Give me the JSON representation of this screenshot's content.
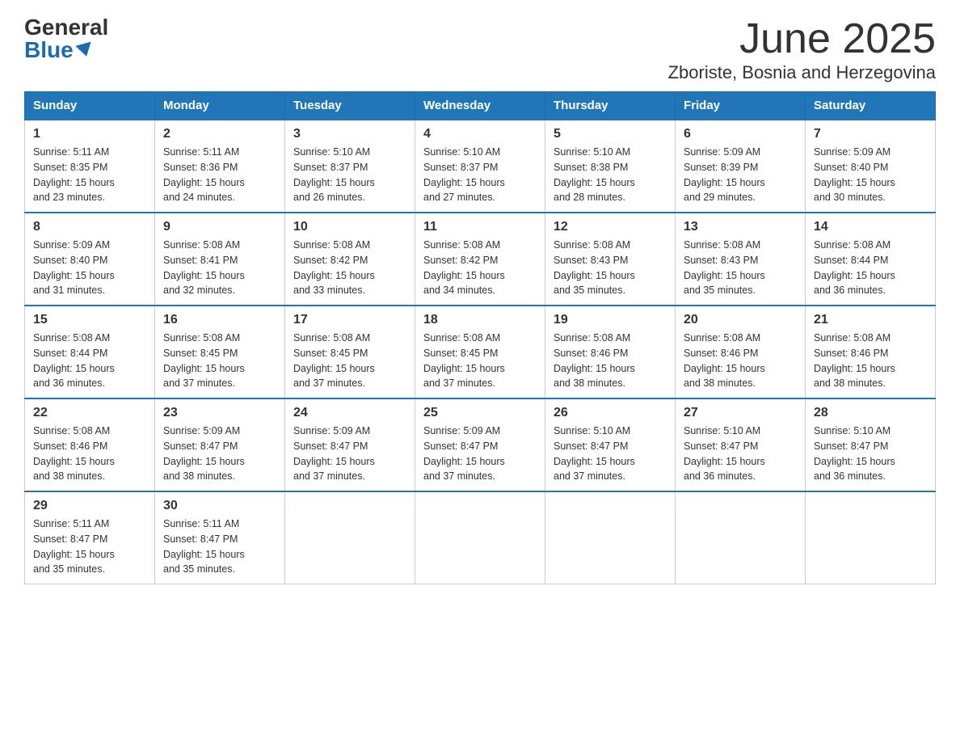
{
  "logo": {
    "general": "General",
    "blue": "Blue"
  },
  "title": "June 2025",
  "location": "Zboriste, Bosnia and Herzegovina",
  "weekdays": [
    "Sunday",
    "Monday",
    "Tuesday",
    "Wednesday",
    "Thursday",
    "Friday",
    "Saturday"
  ],
  "weeks": [
    [
      {
        "day": "1",
        "sunrise": "5:11 AM",
        "sunset": "8:35 PM",
        "daylight": "15 hours and 23 minutes."
      },
      {
        "day": "2",
        "sunrise": "5:11 AM",
        "sunset": "8:36 PM",
        "daylight": "15 hours and 24 minutes."
      },
      {
        "day": "3",
        "sunrise": "5:10 AM",
        "sunset": "8:37 PM",
        "daylight": "15 hours and 26 minutes."
      },
      {
        "day": "4",
        "sunrise": "5:10 AM",
        "sunset": "8:37 PM",
        "daylight": "15 hours and 27 minutes."
      },
      {
        "day": "5",
        "sunrise": "5:10 AM",
        "sunset": "8:38 PM",
        "daylight": "15 hours and 28 minutes."
      },
      {
        "day": "6",
        "sunrise": "5:09 AM",
        "sunset": "8:39 PM",
        "daylight": "15 hours and 29 minutes."
      },
      {
        "day": "7",
        "sunrise": "5:09 AM",
        "sunset": "8:40 PM",
        "daylight": "15 hours and 30 minutes."
      }
    ],
    [
      {
        "day": "8",
        "sunrise": "5:09 AM",
        "sunset": "8:40 PM",
        "daylight": "15 hours and 31 minutes."
      },
      {
        "day": "9",
        "sunrise": "5:08 AM",
        "sunset": "8:41 PM",
        "daylight": "15 hours and 32 minutes."
      },
      {
        "day": "10",
        "sunrise": "5:08 AM",
        "sunset": "8:42 PM",
        "daylight": "15 hours and 33 minutes."
      },
      {
        "day": "11",
        "sunrise": "5:08 AM",
        "sunset": "8:42 PM",
        "daylight": "15 hours and 34 minutes."
      },
      {
        "day": "12",
        "sunrise": "5:08 AM",
        "sunset": "8:43 PM",
        "daylight": "15 hours and 35 minutes."
      },
      {
        "day": "13",
        "sunrise": "5:08 AM",
        "sunset": "8:43 PM",
        "daylight": "15 hours and 35 minutes."
      },
      {
        "day": "14",
        "sunrise": "5:08 AM",
        "sunset": "8:44 PM",
        "daylight": "15 hours and 36 minutes."
      }
    ],
    [
      {
        "day": "15",
        "sunrise": "5:08 AM",
        "sunset": "8:44 PM",
        "daylight": "15 hours and 36 minutes."
      },
      {
        "day": "16",
        "sunrise": "5:08 AM",
        "sunset": "8:45 PM",
        "daylight": "15 hours and 37 minutes."
      },
      {
        "day": "17",
        "sunrise": "5:08 AM",
        "sunset": "8:45 PM",
        "daylight": "15 hours and 37 minutes."
      },
      {
        "day": "18",
        "sunrise": "5:08 AM",
        "sunset": "8:45 PM",
        "daylight": "15 hours and 37 minutes."
      },
      {
        "day": "19",
        "sunrise": "5:08 AM",
        "sunset": "8:46 PM",
        "daylight": "15 hours and 38 minutes."
      },
      {
        "day": "20",
        "sunrise": "5:08 AM",
        "sunset": "8:46 PM",
        "daylight": "15 hours and 38 minutes."
      },
      {
        "day": "21",
        "sunrise": "5:08 AM",
        "sunset": "8:46 PM",
        "daylight": "15 hours and 38 minutes."
      }
    ],
    [
      {
        "day": "22",
        "sunrise": "5:08 AM",
        "sunset": "8:46 PM",
        "daylight": "15 hours and 38 minutes."
      },
      {
        "day": "23",
        "sunrise": "5:09 AM",
        "sunset": "8:47 PM",
        "daylight": "15 hours and 38 minutes."
      },
      {
        "day": "24",
        "sunrise": "5:09 AM",
        "sunset": "8:47 PM",
        "daylight": "15 hours and 37 minutes."
      },
      {
        "day": "25",
        "sunrise": "5:09 AM",
        "sunset": "8:47 PM",
        "daylight": "15 hours and 37 minutes."
      },
      {
        "day": "26",
        "sunrise": "5:10 AM",
        "sunset": "8:47 PM",
        "daylight": "15 hours and 37 minutes."
      },
      {
        "day": "27",
        "sunrise": "5:10 AM",
        "sunset": "8:47 PM",
        "daylight": "15 hours and 36 minutes."
      },
      {
        "day": "28",
        "sunrise": "5:10 AM",
        "sunset": "8:47 PM",
        "daylight": "15 hours and 36 minutes."
      }
    ],
    [
      {
        "day": "29",
        "sunrise": "5:11 AM",
        "sunset": "8:47 PM",
        "daylight": "15 hours and 35 minutes."
      },
      {
        "day": "30",
        "sunrise": "5:11 AM",
        "sunset": "8:47 PM",
        "daylight": "15 hours and 35 minutes."
      },
      null,
      null,
      null,
      null,
      null
    ]
  ],
  "labels": {
    "sunrise": "Sunrise:",
    "sunset": "Sunset:",
    "daylight": "Daylight:"
  },
  "colors": {
    "header_bg": "#2176b8",
    "header_text": "#ffffff",
    "border": "#2176b8"
  }
}
